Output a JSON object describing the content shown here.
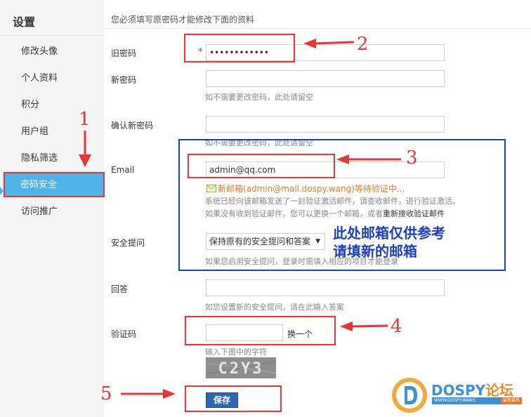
{
  "sidebar": {
    "title": "设置",
    "items": [
      {
        "label": "修改头像"
      },
      {
        "label": "个人资料"
      },
      {
        "label": "积分"
      },
      {
        "label": "用户组"
      },
      {
        "label": "隐私筛选"
      },
      {
        "label": "密码安全",
        "active": true
      },
      {
        "label": "访问推广"
      }
    ]
  },
  "main": {
    "notice": "您必须填写原密码才能修改下面的资料",
    "old_password": {
      "label": "旧密码",
      "required_mark": "*",
      "value": "••••••••••••"
    },
    "new_password": {
      "label": "新密码",
      "value": "",
      "hint": "如不需要更改密码，此处请留空"
    },
    "confirm_password": {
      "label": "确认新密码",
      "value": "",
      "hint": "如不需要更改密码，此处请留空"
    },
    "email": {
      "label": "Email",
      "value": "admin@qq.com",
      "warning": "新邮箱(admin@mail.dospy.wang)等待验证中...",
      "hint_line1": "系统已经向该邮箱发送了一封验证激活邮件，请查收邮件，进行验证激活。",
      "hint_line2": "如果没有收到验证邮件，您可以更换一个邮箱，或者",
      "resend_link": "重新接收验证邮件"
    },
    "security_question": {
      "label": "安全提问",
      "selected": "保持原有的安全提问和答案",
      "hint": "如果您启用安全提问，登录时需填入相应的项目才能登录"
    },
    "answer": {
      "label": "回答",
      "value": "",
      "hint": "如您设置新的安全提问，请在此输入答案"
    },
    "captcha": {
      "label": "验证码",
      "value": "",
      "refresh": "换一个",
      "hint": "输入下图中的字符",
      "image_text": "C2Y3"
    },
    "save_label": "保存"
  },
  "annotations": {
    "n1": "1",
    "n2": "2",
    "n3": "3",
    "n4": "4",
    "n5": "5",
    "note_line1": "此处邮箱仅供参考",
    "note_line2": "请填新的邮箱"
  },
  "logo": {
    "name": "DOSPY",
    "name_cn": "论坛",
    "sub": "WWW.DOSPY.WANG",
    "tag": "最新最热"
  },
  "colors": {
    "accent": "#4fb4e8",
    "annotation_red": "#e8353a",
    "annotation_blue": "#1c3fbe",
    "save_button": "#2d65b5",
    "warning": "#e8782a"
  }
}
